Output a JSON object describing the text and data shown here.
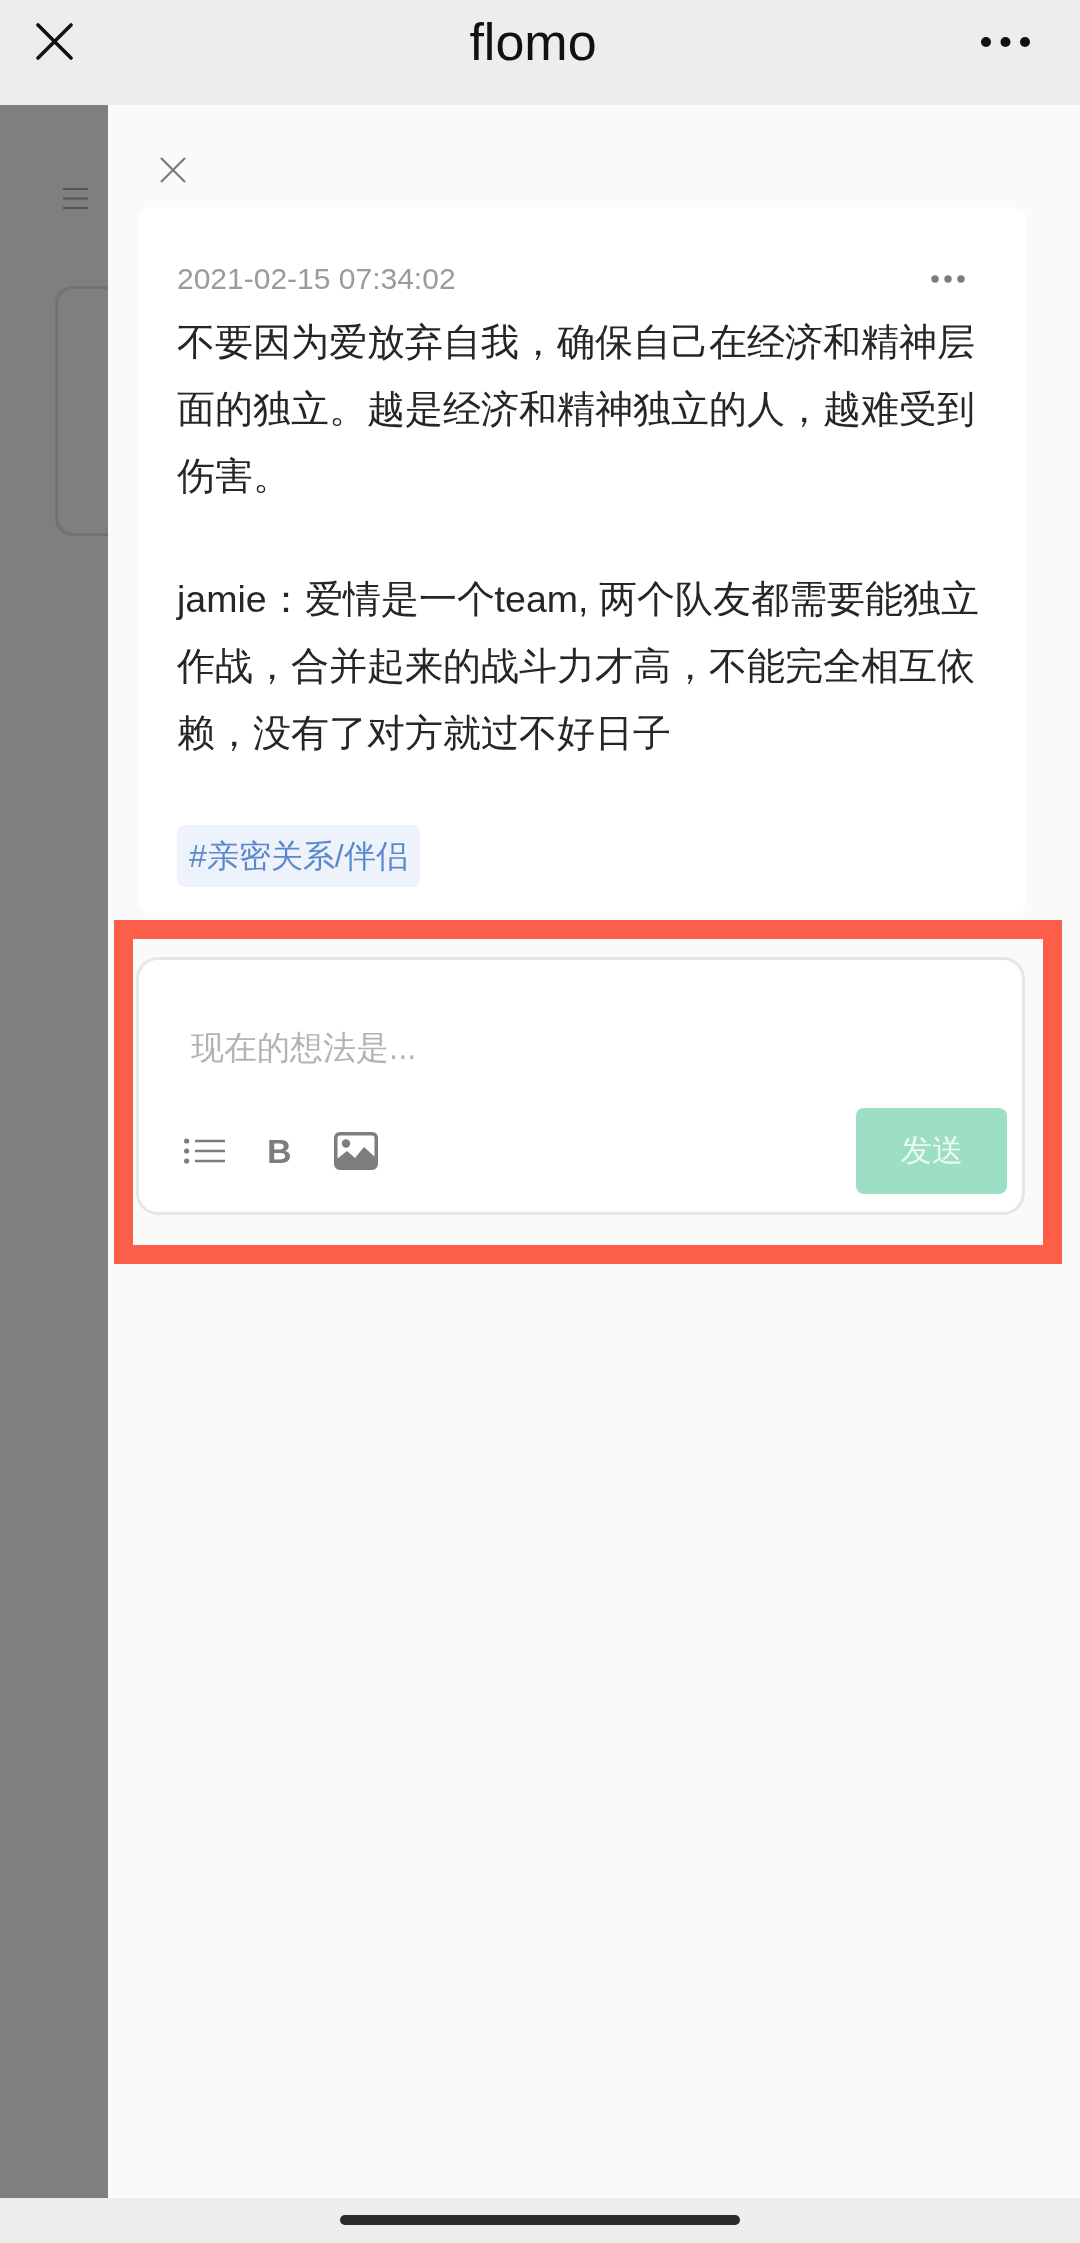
{
  "window": {
    "title": "flomo"
  },
  "memo": {
    "timestamp": "2021-02-15 07:34:02",
    "paragraphs": [
      "不要因为爱放弃自我，确保自己在经济和精神层面的独立。越是经济和精神独立的人，越难受到伤害。",
      "jamie：爱情是一个team, 两个队友都需要能独立作战，合并起来的战斗力才高，不能完全相互依赖，没有了对方就过不好日子"
    ],
    "tags": [
      "#亲密关系/伴侣"
    ]
  },
  "composer": {
    "highlighted": true,
    "placeholder": "现在的想法是...",
    "tools": [
      {
        "kind": "list"
      },
      {
        "kind": "bold",
        "label": "B"
      },
      {
        "kind": "image"
      }
    ],
    "send_button": {
      "label": "发送",
      "disabled": true
    }
  }
}
